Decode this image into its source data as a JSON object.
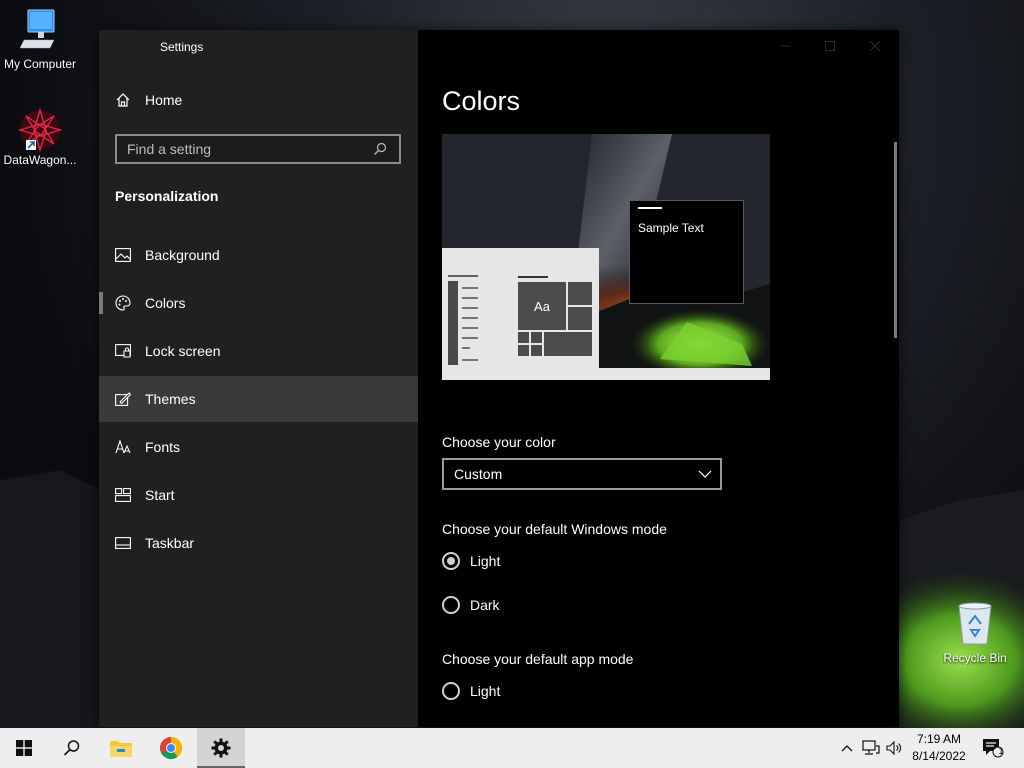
{
  "desktop": {
    "icons": [
      {
        "label": "My Computer"
      },
      {
        "label": "DataWagon..."
      },
      {
        "label": "Recycle Bin"
      }
    ]
  },
  "window": {
    "title": "Settings"
  },
  "sidebar": {
    "home_label": "Home",
    "search_placeholder": "Find a setting",
    "section_title": "Personalization",
    "items": [
      {
        "label": "Background",
        "icon": "image-icon"
      },
      {
        "label": "Colors",
        "icon": "palette-icon"
      },
      {
        "label": "Lock screen",
        "icon": "lock-screen-icon"
      },
      {
        "label": "Themes",
        "icon": "themes-icon"
      },
      {
        "label": "Fonts",
        "icon": "fonts-icon"
      },
      {
        "label": "Start",
        "icon": "start-icon"
      },
      {
        "label": "Taskbar",
        "icon": "taskbar-icon"
      }
    ]
  },
  "content": {
    "title": "Colors",
    "preview": {
      "sample_text": "Sample Text",
      "tile_text": "Aa"
    },
    "choose_color_label": "Choose your color",
    "color_dropdown_value": "Custom",
    "windows_mode_label": "Choose your default Windows mode",
    "windows_mode_options": [
      "Light",
      "Dark"
    ],
    "windows_mode_selected": "Light",
    "app_mode_label": "Choose your default app mode",
    "app_mode_options": [
      "Light"
    ]
  },
  "taskbar": {
    "time": "7:19 AM",
    "date": "8/14/2022",
    "notification_count": "1"
  },
  "colors": {
    "sidebar_bg": "#202020",
    "content_bg": "#000000",
    "taskbar_bg": "#eeeeee",
    "hover_bg": "#3a3a3a"
  }
}
